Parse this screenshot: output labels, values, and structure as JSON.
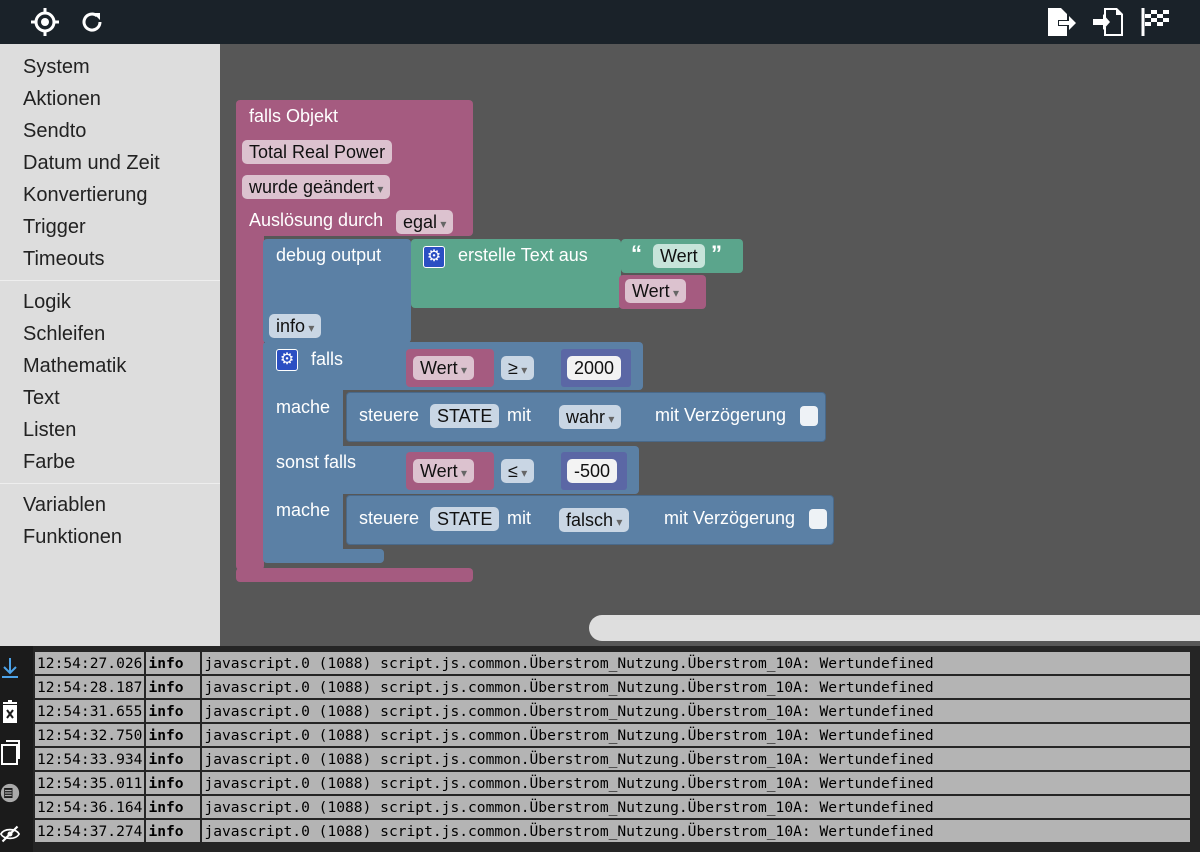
{
  "toolbar": {
    "left_icons": [
      "crosshair-icon",
      "refresh-icon"
    ],
    "right_icons": [
      "export-icon",
      "import-icon",
      "checkered-flag-icon"
    ]
  },
  "toolbox": {
    "groups": [
      [
        "System",
        "Aktionen",
        "Sendto",
        "Datum und Zeit",
        "Konvertierung",
        "Trigger",
        "Timeouts"
      ],
      [
        "Logik",
        "Schleifen",
        "Mathematik",
        "Text",
        "Listen",
        "Farbe"
      ],
      [
        "Variablen",
        "Funktionen"
      ]
    ]
  },
  "blocks": {
    "event": {
      "title": "falls Objekt",
      "object": "Total Real Power",
      "condition": "wurde geändert",
      "trigger_label": "Auslösung durch",
      "trigger_value": "egal"
    },
    "debug": {
      "label": "debug output",
      "level": "info",
      "text_join_label": "erstelle Text aus",
      "text_literal": "Wert",
      "text_variable": "Wert"
    },
    "if_block": {
      "if_label": "falls",
      "do_label": "mache",
      "elseif_label": "sonst falls",
      "do2_label": "mache",
      "cond1": {
        "var": "Wert",
        "op": "≥",
        "value": "2000"
      },
      "action1": {
        "label": "steuere",
        "state": "STATE",
        "mit": "mit",
        "value": "wahr",
        "delay_label": "mit Verzögerung"
      },
      "cond2": {
        "var": "Wert",
        "op": "≤",
        "value": "-500"
      },
      "action2": {
        "label": "steuere",
        "state": "STATE",
        "mit": "mit",
        "value": "falsch",
        "delay_label": "mit Verzögerung"
      }
    }
  },
  "log": {
    "side_icons": [
      "scroll-down-icon",
      "clear-log-icon",
      "copy-icon",
      "columns-icon",
      "hide-icon"
    ],
    "entries": [
      {
        "time": "12:54:27.026",
        "severity": "info",
        "message": "javascript.0 (1088) script.js.common.Überstrom_Nutzung.Überstrom_10A: Wertundefined"
      },
      {
        "time": "12:54:28.187",
        "severity": "info",
        "message": "javascript.0 (1088) script.js.common.Überstrom_Nutzung.Überstrom_10A: Wertundefined"
      },
      {
        "time": "12:54:31.655",
        "severity": "info",
        "message": "javascript.0 (1088) script.js.common.Überstrom_Nutzung.Überstrom_10A: Wertundefined"
      },
      {
        "time": "12:54:32.750",
        "severity": "info",
        "message": "javascript.0 (1088) script.js.common.Überstrom_Nutzung.Überstrom_10A: Wertundefined"
      },
      {
        "time": "12:54:33.934",
        "severity": "info",
        "message": "javascript.0 (1088) script.js.common.Überstrom_Nutzung.Überstrom_10A: Wertundefined"
      },
      {
        "time": "12:54:35.011",
        "severity": "info",
        "message": "javascript.0 (1088) script.js.common.Überstrom_Nutzung.Überstrom_10A: Wertundefined"
      },
      {
        "time": "12:54:36.164",
        "severity": "info",
        "message": "javascript.0 (1088) script.js.common.Überstrom_Nutzung.Überstrom_10A: Wertundefined"
      },
      {
        "time": "12:54:37.274",
        "severity": "info",
        "message": "javascript.0 (1088) script.js.common.Überstrom_Nutzung.Überstrom_10A: Wertundefined"
      }
    ]
  },
  "colors": {
    "event_block": "#a55b80",
    "logic_block": "#5b80a5",
    "text_block": "#5ba58c",
    "math_block": "#5b67a5",
    "toolbar_bg": "#1a2229",
    "workspace_bg": "#575757"
  }
}
